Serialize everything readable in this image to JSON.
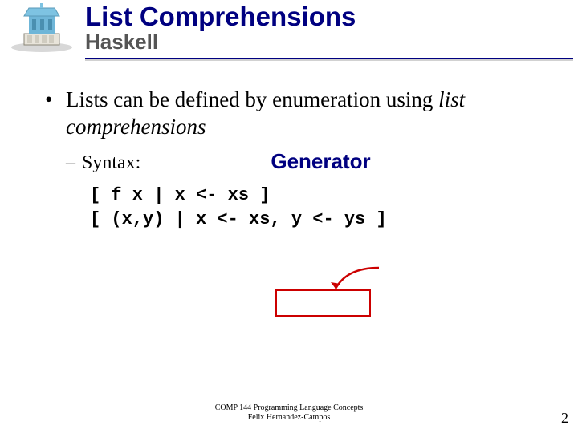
{
  "header": {
    "title": "List Comprehensions",
    "subtitle": "Haskell"
  },
  "bullet": {
    "text_plain": "Lists can be defined by enumeration using ",
    "text_italic": "list comprehensions"
  },
  "sub": {
    "label": "Syntax:",
    "callout": "Generator"
  },
  "code": {
    "line1": "[ f x | x <- xs ]",
    "line2": "[ (x,y) | x <- xs, y <- ys ]"
  },
  "footer": {
    "line1": "COMP 144 Programming Language Concepts",
    "line2": "Felix Hernandez-Campos"
  },
  "page": "2"
}
